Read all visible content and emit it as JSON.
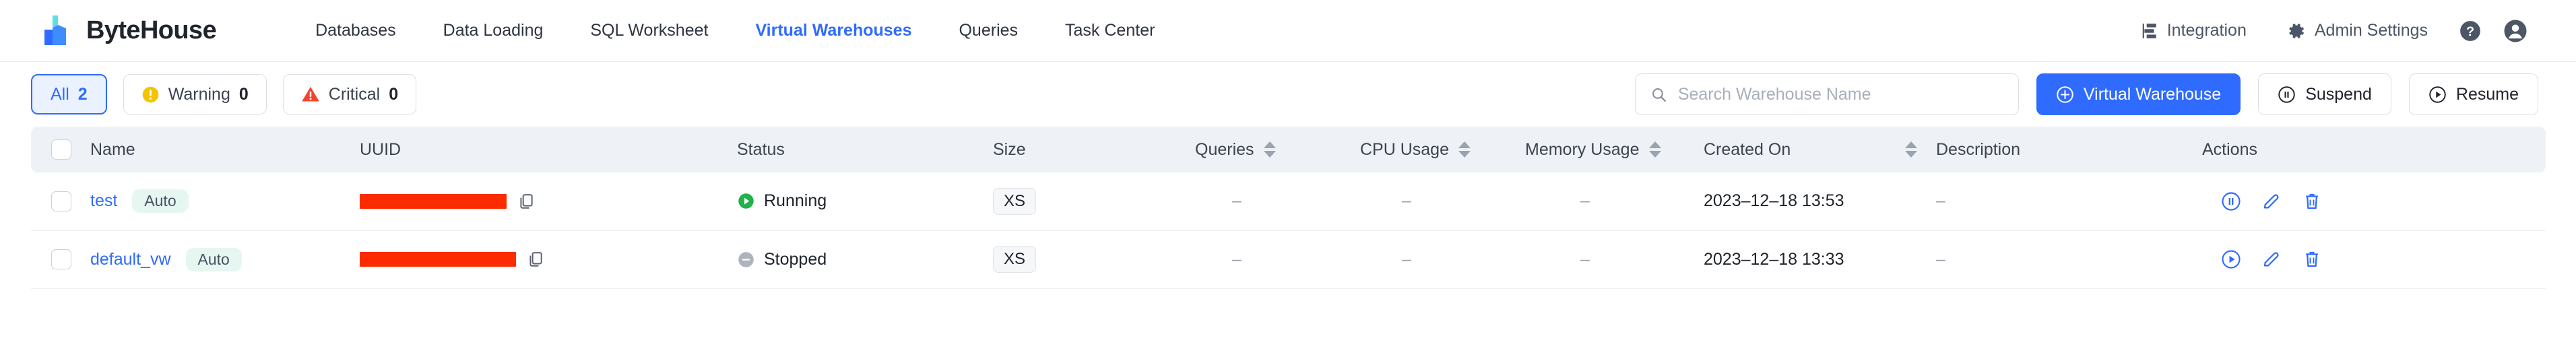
{
  "header": {
    "brand": "ByteHouse",
    "logo_colors": {
      "cyan": "#5ce0e6",
      "blue_dark": "#2f6bff",
      "blue_light": "#3f8cff"
    },
    "nav": [
      {
        "label": "Databases",
        "active": false
      },
      {
        "label": "Data Loading",
        "active": false
      },
      {
        "label": "SQL Worksheet",
        "active": false
      },
      {
        "label": "Virtual Warehouses",
        "active": true
      },
      {
        "label": "Queries",
        "active": false
      },
      {
        "label": "Task Center",
        "active": false
      }
    ],
    "right": {
      "integration": "Integration",
      "admin_settings": "Admin Settings",
      "help_icon": "help-circle-icon",
      "avatar_icon": "user-avatar-icon"
    }
  },
  "toolbar": {
    "chips": [
      {
        "label": "All",
        "count": "2",
        "selected": true,
        "icon": "none"
      },
      {
        "label": "Warning",
        "count": "0",
        "selected": false,
        "icon": "warning-circle-icon"
      },
      {
        "label": "Critical",
        "count": "0",
        "selected": false,
        "icon": "critical-triangle-icon"
      }
    ],
    "search_placeholder": "Search Warehouse Name",
    "search_value": "",
    "create_button": "Virtual Warehouse",
    "suspend_button": "Suspend",
    "resume_button": "Resume"
  },
  "table": {
    "columns": [
      {
        "label": "Name",
        "sortable": false
      },
      {
        "label": "UUID",
        "sortable": false
      },
      {
        "label": "Status",
        "sortable": false
      },
      {
        "label": "Size",
        "sortable": false
      },
      {
        "label": "Queries",
        "sortable": true
      },
      {
        "label": "CPU Usage",
        "sortable": true
      },
      {
        "label": "Memory Usage",
        "sortable": true
      },
      {
        "label": "Created On",
        "sortable": true
      },
      {
        "label": "Description",
        "sortable": false
      },
      {
        "label": "Actions",
        "sortable": false
      }
    ],
    "rows": [
      {
        "name": "test",
        "badge": "Auto",
        "uuid": "",
        "status": "Running",
        "status_icon": "running-play-icon",
        "size": "XS",
        "queries": "–",
        "cpu_usage": "–",
        "memory_usage": "–",
        "created_on": "2023–12–18 13:53",
        "description": "–",
        "actions": [
          "pause-icon",
          "edit-icon",
          "delete-icon"
        ]
      },
      {
        "name": "default_vw",
        "badge": "Auto",
        "uuid": "",
        "status": "Stopped",
        "status_icon": "stopped-minus-icon",
        "size": "XS",
        "queries": "–",
        "cpu_usage": "–",
        "memory_usage": "–",
        "created_on": "2023–12–18 13:33",
        "description": "–",
        "actions": [
          "play-icon",
          "edit-icon",
          "delete-icon"
        ]
      }
    ]
  },
  "colors": {
    "accent": "#2f6bff",
    "running_green": "#21b24b",
    "stopped_gray": "#aeb4bd",
    "warning_yellow": "#f5c400",
    "critical_red": "#f5442c",
    "redaction_red": "#fc2b00"
  }
}
